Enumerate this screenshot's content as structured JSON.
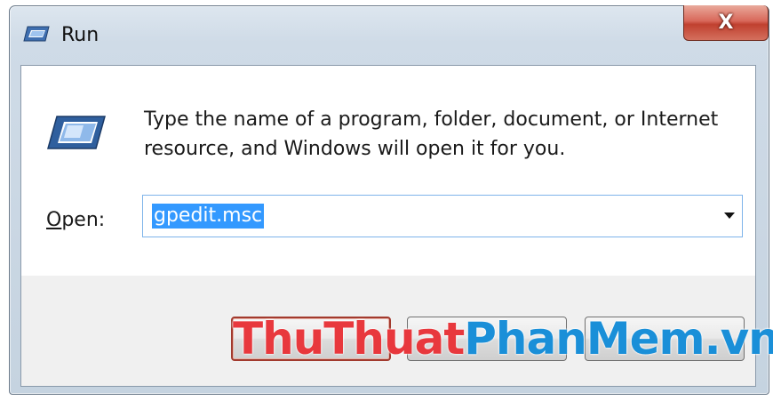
{
  "window": {
    "title": "Run",
    "close_label": "X"
  },
  "dialog": {
    "message": "Type the name of a program, folder, document, or Internet resource, and Windows will open it for you.",
    "open_label_accel": "O",
    "open_label_rest": "pen:",
    "input_value": "gpedit.msc"
  },
  "buttons": {
    "ok_label": "",
    "cancel_label": "",
    "browse_label": ""
  },
  "watermark": {
    "part1": "ThuThuat",
    "part2": "PhanMem.vn"
  },
  "colors": {
    "selection": "#3399ff",
    "close_button": "#c0402f",
    "watermark_red": "#e8383d",
    "watermark_blue": "#1a8fd8"
  }
}
